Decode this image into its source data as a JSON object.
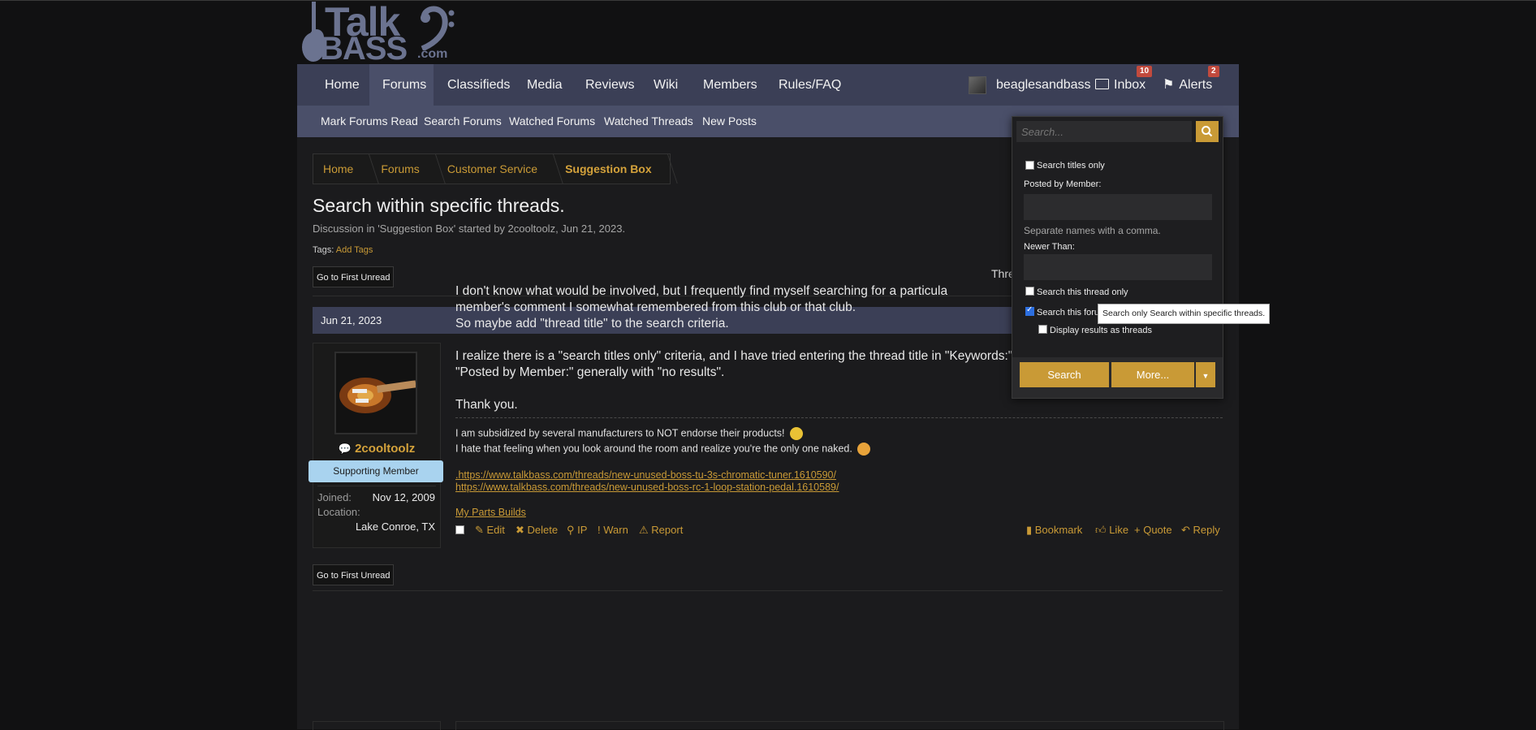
{
  "logo": {
    "line1": "Talk",
    "line2": "BASS",
    "line3": ".com"
  },
  "nav": {
    "items": [
      "Home",
      "Forums",
      "Classifieds",
      "Media",
      "Reviews",
      "Wiki",
      "Members",
      "Rules/FAQ"
    ],
    "active": "Forums",
    "username": "beaglesandbass",
    "inbox_label": "Inbox",
    "inbox_count": "10",
    "alerts_label": "Alerts",
    "alerts_count": "2"
  },
  "subnav": [
    "Mark Forums Read",
    "Search Forums",
    "Watched Forums",
    "Watched Threads",
    "New Posts"
  ],
  "breadcrumb": [
    "Home",
    "Forums",
    "Customer Service",
    "Suggestion Box"
  ],
  "thread": {
    "title": "Search within specific threads.",
    "meta": "Discussion in 'Suggestion Box' started by 2cooltoolz, Jun 21, 2023.",
    "tags_label": "Tags:",
    "add_tags": "Add Tags",
    "first_unread": "Go to First Unread",
    "thread_tools_partial": "Thre"
  },
  "post": {
    "date": "Jun 21, 2023",
    "author": "2cooltoolz",
    "role": "Supporting Member",
    "joined_label": "Joined:",
    "joined": "Nov 12, 2009",
    "location_label": "Location:",
    "location": "Lake Conroe, TX",
    "lines": [
      "I don't know what would be involved, but I frequently find myself searching for a particula",
      "member's comment I somewhat remembered from this club or that club.",
      "So maybe add \"thread title\" to the search criteria.",
      "I realize there is a \"search titles only\" criteria, and I have tried entering the thread title in \"Keywords:\", box checked,",
      "\"Posted by Member:\" generally with \"no results\".",
      "Thank you."
    ],
    "signature": [
      "I am subsidized by several manufacturers to NOT endorse their products!",
      "I hate that feeling when you look around the room and realize you're the only one naked."
    ],
    "links": [
      ".https://www.talkbass.com/threads/new-unused-boss-tu-3s-chromatic-tuner.1610590/",
      "https://www.talkbass.com/threads/new-unused-boss-rc-1-loop-station-pedal.1610589/",
      "My Parts Builds"
    ],
    "actions_left": [
      "Edit",
      "Delete",
      "IP",
      "Warn",
      "Report"
    ],
    "actions_right": [
      "Bookmark",
      "Like",
      "+ Quote",
      "Reply"
    ]
  },
  "search_popup": {
    "placeholder": "Search...",
    "titles_only": "Search titles only",
    "posted_by": "Posted by Member:",
    "separate_hint": "Separate names with a comma.",
    "newer_than": "Newer Than:",
    "this_thread": "Search this thread only",
    "this_forum": "Search this foru",
    "display_threads": "Display results as threads",
    "search_btn": "Search",
    "more_btn": "More...",
    "tooltip": "Search only Search within specific threads."
  },
  "colors": {
    "accent": "#c99a36",
    "nav": "#3b3f56",
    "subnav": "#4a4f69",
    "badge": "#c24a3d",
    "role": "#a9d3ef"
  }
}
